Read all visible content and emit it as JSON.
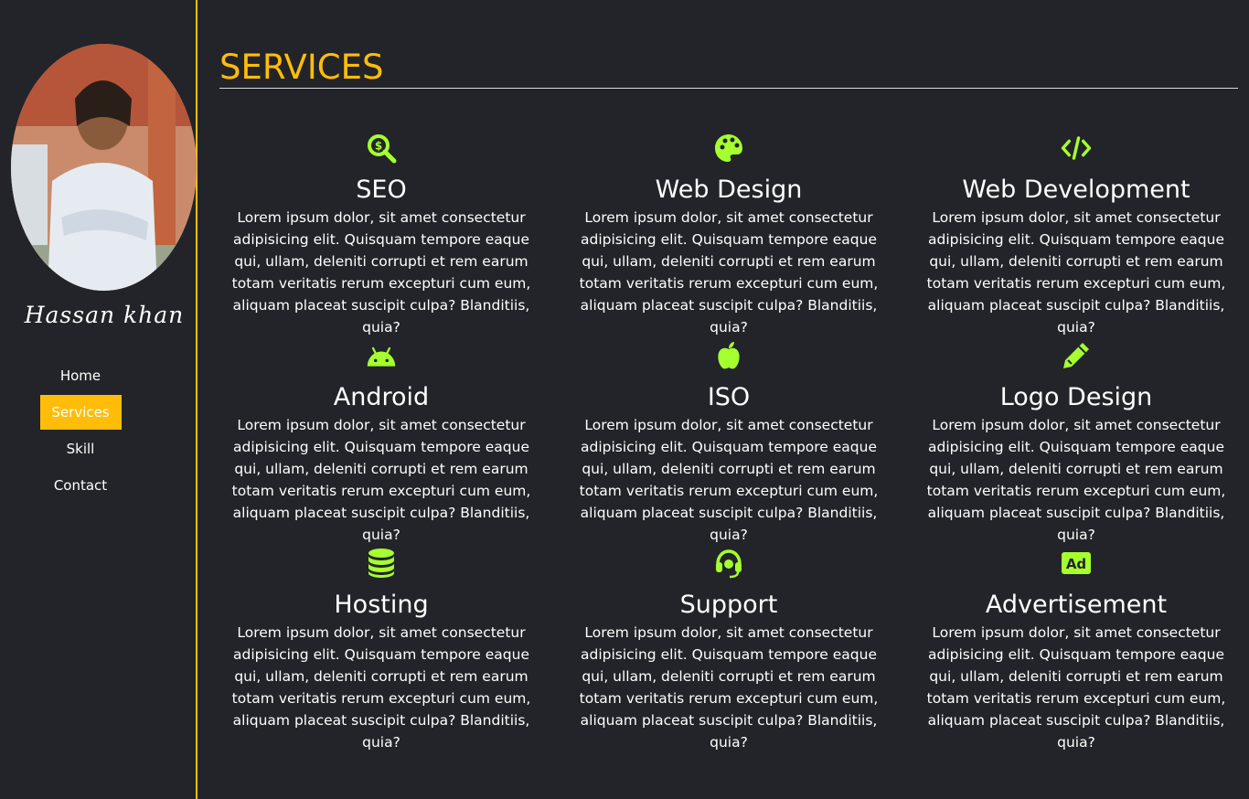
{
  "sidebar": {
    "name": "Hassan khan",
    "nav": [
      "Home",
      "Services",
      "Skill",
      "Contact"
    ],
    "active": "Services"
  },
  "main": {
    "title": "SERVICES",
    "cards": [
      {
        "icon": "seo-search-dollar-icon",
        "title": "SEO",
        "text": "Lorem ipsum dolor, sit amet consectetur adipisicing elit. Quisquam tempore eaque qui, ullam, deleniti corrupti et rem earum totam veritatis rerum excepturi cum eum, aliquam placeat suscipit culpa? Blanditiis, quia?"
      },
      {
        "icon": "palette-icon",
        "title": "Web Design",
        "text": "Lorem ipsum dolor, sit amet consectetur adipisicing elit. Quisquam tempore eaque qui, ullam, deleniti corrupti et rem earum totam veritatis rerum excepturi cum eum, aliquam placeat suscipit culpa? Blanditiis, quia?"
      },
      {
        "icon": "code-icon",
        "title": "Web Development",
        "text": "Lorem ipsum dolor, sit amet consectetur adipisicing elit. Quisquam tempore eaque qui, ullam, deleniti corrupti et rem earum totam veritatis rerum excepturi cum eum, aliquam placeat suscipit culpa? Blanditiis, quia?"
      },
      {
        "icon": "android-icon",
        "title": "Android",
        "text": "Lorem ipsum dolor, sit amet consectetur adipisicing elit. Quisquam tempore eaque qui, ullam, deleniti corrupti et rem earum totam veritatis rerum excepturi cum eum, aliquam placeat suscipit culpa? Blanditiis, quia?"
      },
      {
        "icon": "apple-icon",
        "title": "ISO",
        "text": "Lorem ipsum dolor, sit amet consectetur adipisicing elit. Quisquam tempore eaque qui, ullam, deleniti corrupti et rem earum totam veritatis rerum excepturi cum eum, aliquam placeat suscipit culpa? Blanditiis, quia?"
      },
      {
        "icon": "pencil-icon",
        "title": "Logo Design",
        "text": "Lorem ipsum dolor, sit amet consectetur adipisicing elit. Quisquam tempore eaque qui, ullam, deleniti corrupti et rem earum totam veritatis rerum excepturi cum eum, aliquam placeat suscipit culpa? Blanditiis, quia?"
      },
      {
        "icon": "database-icon",
        "title": "Hosting",
        "text": "Lorem ipsum dolor, sit amet consectetur adipisicing elit. Quisquam tempore eaque qui, ullam, deleniti corrupti et rem earum totam veritatis rerum excepturi cum eum, aliquam placeat suscipit culpa? Blanditiis, quia?"
      },
      {
        "icon": "headset-icon",
        "title": "Support",
        "text": "Lorem ipsum dolor, sit amet consectetur adipisicing elit. Quisquam tempore eaque qui, ullam, deleniti corrupti et rem earum totam veritatis rerum excepturi cum eum, aliquam placeat suscipit culpa? Blanditiis, quia?"
      },
      {
        "icon": "ad-icon",
        "title": "Advertisement",
        "text": "Lorem ipsum dolor, sit amet consectetur adipisicing elit. Quisquam tempore eaque qui, ullam, deleniti corrupti et rem earum totam veritatis rerum excepturi cum eum, aliquam placeat suscipit culpa? Blanditiis, quia?"
      }
    ]
  },
  "colors": {
    "background": "#222429",
    "accent": "#ffbd0a",
    "icon": "#a6ff2e",
    "text": "#ffffff"
  }
}
